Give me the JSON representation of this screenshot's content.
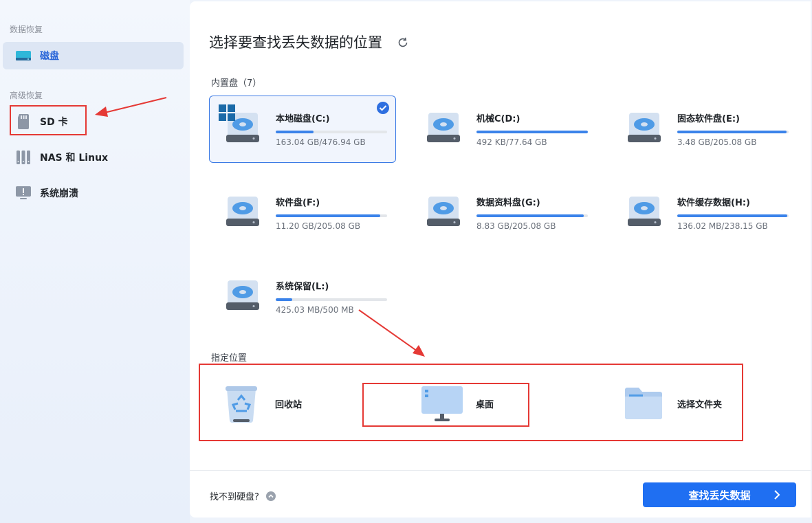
{
  "sidebar": {
    "section_data": "数据恢复",
    "section_advanced": "高级恢复",
    "items": [
      {
        "label": "磁盘"
      },
      {
        "label": "SD 卡"
      },
      {
        "label": "NAS 和 Linux"
      },
      {
        "label": "系统崩溃"
      }
    ]
  },
  "main": {
    "title": "选择要查找丢失数据的位置",
    "internal_label": "内置盘（7）",
    "drives": [
      {
        "name": "本地磁盘(C:)",
        "size": "163.04 GB/476.94 GB",
        "used_fraction": 0.34
      },
      {
        "name": "机械C(D:)",
        "size": "492 KB/77.64 GB",
        "used_fraction": 1.0
      },
      {
        "name": "固态软件盘(E:)",
        "size": "3.48 GB/205.08 GB",
        "used_fraction": 0.98
      },
      {
        "name": "软件盘(F:)",
        "size": "11.20 GB/205.08 GB",
        "used_fraction": 0.94
      },
      {
        "name": "数据资料盘(G:)",
        "size": "8.83 GB/205.08 GB",
        "used_fraction": 0.96
      },
      {
        "name": "软件缓存数据(H:)",
        "size": "136.02 MB/238.15 GB",
        "used_fraction": 0.99
      },
      {
        "name": "系统保留(L:)",
        "size": "425.03 MB/500 MB",
        "used_fraction": 0.15
      }
    ],
    "location_label": "指定位置",
    "locations": [
      {
        "name": "回收站"
      },
      {
        "name": "桌面"
      },
      {
        "name": "选择文件夹"
      }
    ]
  },
  "footer": {
    "not_found": "找不到硬盘?",
    "scan_button": "查找丢失数据"
  },
  "colors": {
    "accent": "#1f6ff2",
    "progress": "#3b83ea",
    "annotation": "#e53935"
  }
}
